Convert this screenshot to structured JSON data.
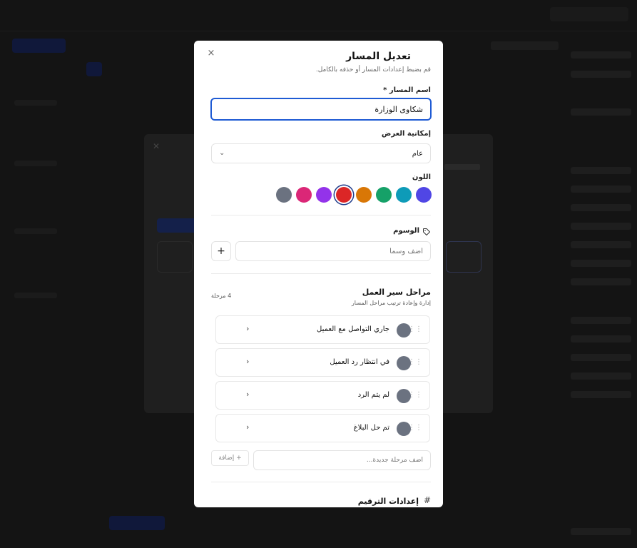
{
  "modal": {
    "title": "تعديل المسار",
    "subtitle": "قم بضبط إعدادات المسار أو حذفه بالكامل.",
    "close_icon": "×",
    "name_label": "اسم المسار",
    "required_mark": "*",
    "name_value": "شكاوى الوزارة",
    "visibility_label": "إمكانية العرض",
    "visibility_value": "عام",
    "chevron": "⌄",
    "color_label": "اللون",
    "colors": [
      "#5046e5",
      "#0e9bb8",
      "#16a168",
      "#d97706",
      "#dc2626",
      "#9333ea",
      "#db2777",
      "#6b7280"
    ],
    "selected_color": "#dc2626",
    "tags_label": "الوسوم",
    "tag_placeholder": "أضف وسماً",
    "add_tag_symbol": "+",
    "stages_title": "مراحل سير العمل",
    "stages_subtitle": "إدارة وإعادة ترتيب مراحل المسار",
    "stages_count": "4 مرحلة",
    "stages": [
      {
        "name": "جاري التواصل مع العميل"
      },
      {
        "name": "في انتظار رد العميل"
      },
      {
        "name": "لم يتم الرد"
      },
      {
        "name": "تم حل البلاغ"
      }
    ],
    "stage_color": "#6b7280",
    "drag_handle": "⋮⋮",
    "expand_icon": "‹",
    "new_stage_placeholder": "أضف مرحلة جديدة...",
    "add_stage_label": "+ إضافة",
    "numbering_title": "إعدادات الترقيم",
    "hash_symbol": "#"
  }
}
